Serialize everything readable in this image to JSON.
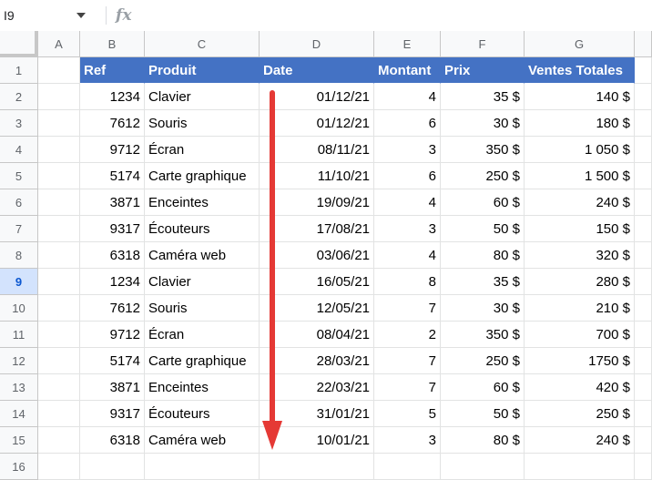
{
  "formula_bar": {
    "cell_ref": "I9",
    "fx": "fx",
    "formula": ""
  },
  "columns": [
    "A",
    "B",
    "C",
    "D",
    "E",
    "F",
    "G"
  ],
  "row_numbers": [
    "1",
    "2",
    "3",
    "4",
    "5",
    "6",
    "7",
    "8",
    "9",
    "10",
    "11",
    "12",
    "13",
    "14",
    "15",
    "16"
  ],
  "selected_row": "9",
  "headers": {
    "ref": "Ref",
    "produit": "Produit",
    "date": "Date",
    "montant": "Montant",
    "prix": "Prix",
    "ventes": "Ventes Totales"
  },
  "rows": [
    {
      "ref": "1234",
      "produit": "Clavier",
      "date": "01/12/21",
      "montant": "4",
      "prix": "35 $",
      "ventes": "140 $"
    },
    {
      "ref": "7612",
      "produit": "Souris",
      "date": "01/12/21",
      "montant": "6",
      "prix": "30 $",
      "ventes": "180 $"
    },
    {
      "ref": "9712",
      "produit": "Écran",
      "date": "08/11/21",
      "montant": "3",
      "prix": "350 $",
      "ventes": "1 050 $"
    },
    {
      "ref": "5174",
      "produit": "Carte graphique",
      "date": "11/10/21",
      "montant": "6",
      "prix": "250 $",
      "ventes": "1 500 $"
    },
    {
      "ref": "3871",
      "produit": "Enceintes",
      "date": "19/09/21",
      "montant": "4",
      "prix": "60 $",
      "ventes": "240 $"
    },
    {
      "ref": "9317",
      "produit": "Écouteurs",
      "date": "17/08/21",
      "montant": "3",
      "prix": "50 $",
      "ventes": "150 $"
    },
    {
      "ref": "6318",
      "produit": "Caméra web",
      "date": "03/06/21",
      "montant": "4",
      "prix": "80 $",
      "ventes": "320 $"
    },
    {
      "ref": "1234",
      "produit": "Clavier",
      "date": "16/05/21",
      "montant": "8",
      "prix": "35 $",
      "ventes": "280 $"
    },
    {
      "ref": "7612",
      "produit": "Souris",
      "date": "12/05/21",
      "montant": "7",
      "prix": "30 $",
      "ventes": "210 $"
    },
    {
      "ref": "9712",
      "produit": "Écran",
      "date": "08/04/21",
      "montant": "2",
      "prix": "350 $",
      "ventes": "700 $"
    },
    {
      "ref": "5174",
      "produit": "Carte graphique",
      "date": "28/03/21",
      "montant": "7",
      "prix": "250 $",
      "ventes": "1750 $"
    },
    {
      "ref": "3871",
      "produit": "Enceintes",
      "date": "22/03/21",
      "montant": "7",
      "prix": "60 $",
      "ventes": "420 $"
    },
    {
      "ref": "9317",
      "produit": "Écouteurs",
      "date": "31/01/21",
      "montant": "5",
      "prix": "50 $",
      "ventes": "250 $"
    },
    {
      "ref": "6318",
      "produit": "Caméra web",
      "date": "10/01/21",
      "montant": "3",
      "prix": "80 $",
      "ventes": "240 $"
    }
  ],
  "colors": {
    "header_fill": "#4472c4",
    "arrow": "#e53935",
    "selected_row": "#d3e3fd"
  },
  "icons": {
    "name_box_dropdown": "chevron-down-icon",
    "formula": "fx-icon",
    "annotation": "arrow-down-icon"
  }
}
